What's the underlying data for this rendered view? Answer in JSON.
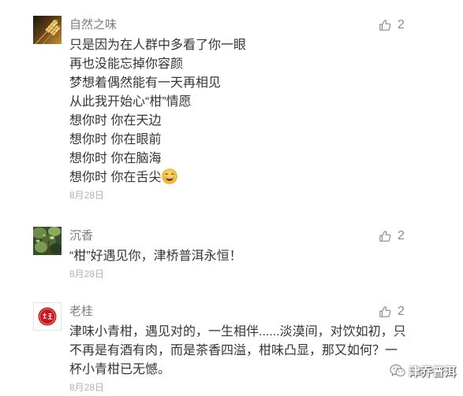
{
  "colors": {
    "text": "#353535",
    "name": "#7d7d7d",
    "date": "#b2b2b2",
    "like": "#8a8a8a",
    "avatar_badge_red": "#c8161d"
  },
  "icons": {
    "like": "thumbs-up-icon",
    "emoji": "grinning-face-emoji",
    "watermark": "wechat-icon"
  },
  "comments": [
    {
      "name": "自然之味",
      "likes": "2",
      "lines": [
        "只是因为在人群中多看了你一眼",
        "再也没能忘掉你容颜",
        "梦想着偶然能有一天再相见",
        "从此我开始心“柑”情愿",
        "想你时 你在天边",
        "想你时 你在眼前",
        "想你时 你在脑海",
        "想你时 你在舌尖"
      ],
      "date": "8月28日"
    },
    {
      "name": "沉香",
      "likes": "2",
      "lines": [
        "“柑”好遇见你，津桥普洱永恒！"
      ],
      "date": "8月28日"
    },
    {
      "name": "老桂",
      "likes": "2",
      "lines": [
        "津味小青柑，遇见对的，一生相伴......淡漠间，对饮如初，只",
        "不再是有酒有肉，而是茶香四溢，柑味凸显，那又如何？一",
        "杯小青柑已无憾。"
      ],
      "date": "8月28日"
    }
  ],
  "watermark": {
    "text": "津乔普洱"
  }
}
